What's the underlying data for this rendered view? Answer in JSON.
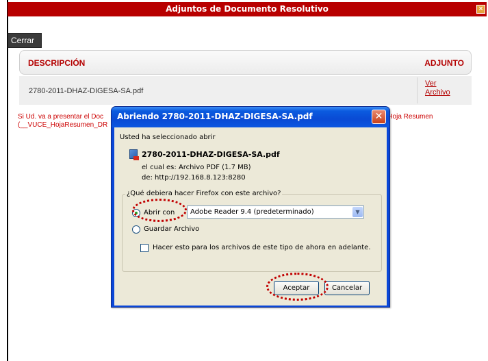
{
  "window": {
    "title": "Adjuntos de Documento Resolutivo",
    "close_symbol": "×"
  },
  "toolbar": {
    "close_label": "Cerrar"
  },
  "table": {
    "columns": [
      "DESCRIPCIÓN",
      "ADJUNTO"
    ],
    "rows": [
      {
        "description": "2780-2011-DHAZ-DIGESA-SA.pdf",
        "link_line1": "Ver",
        "link_line2": "Archivo"
      }
    ]
  },
  "notice": {
    "line1": "Si Ud. va a presentar el Doc",
    "line2": "(__VUCE_HojaResumen_DR",
    "right_fragment": "a Hoja Resumen"
  },
  "dialog": {
    "title": "Abriendo 2780-2011-DHAZ-DIGESA-SA.pdf",
    "intro": "Usted ha seleccionado abrir",
    "filename": "2780-2011-DHAZ-DIGESA-SA.pdf",
    "type_text": "el cual es:  Archivo PDF (1.7  MB)",
    "from_text": "de:  http://192.168.8.123:8280",
    "question": "¿Qué debiera hacer Firefox con este archivo?",
    "open_with_label": "Abrir con",
    "open_with_app": "Adobe Reader 9.4 (predeterminado)",
    "save_label": "Guardar Archivo",
    "remember_label": "Hacer esto para los archivos de este tipo de ahora en adelante.",
    "accept_label": "Aceptar",
    "cancel_label": "Cancelar",
    "close_symbol": "✕",
    "selected_option": "Abrir con",
    "remember_checked": false
  },
  "colors": {
    "title_bar": "#b80000",
    "header_text": "#b40000",
    "notice_text": "#cc0000",
    "dialog_titlebar": "#0a4ad4",
    "dialog_body": "#ece9d8",
    "annotation": "#c10000"
  },
  "icons": {
    "pdf": "pdf-file-icon",
    "title_close": "close-icon",
    "dialog_close": "close-icon",
    "dropdown": "chevron-down-icon"
  }
}
